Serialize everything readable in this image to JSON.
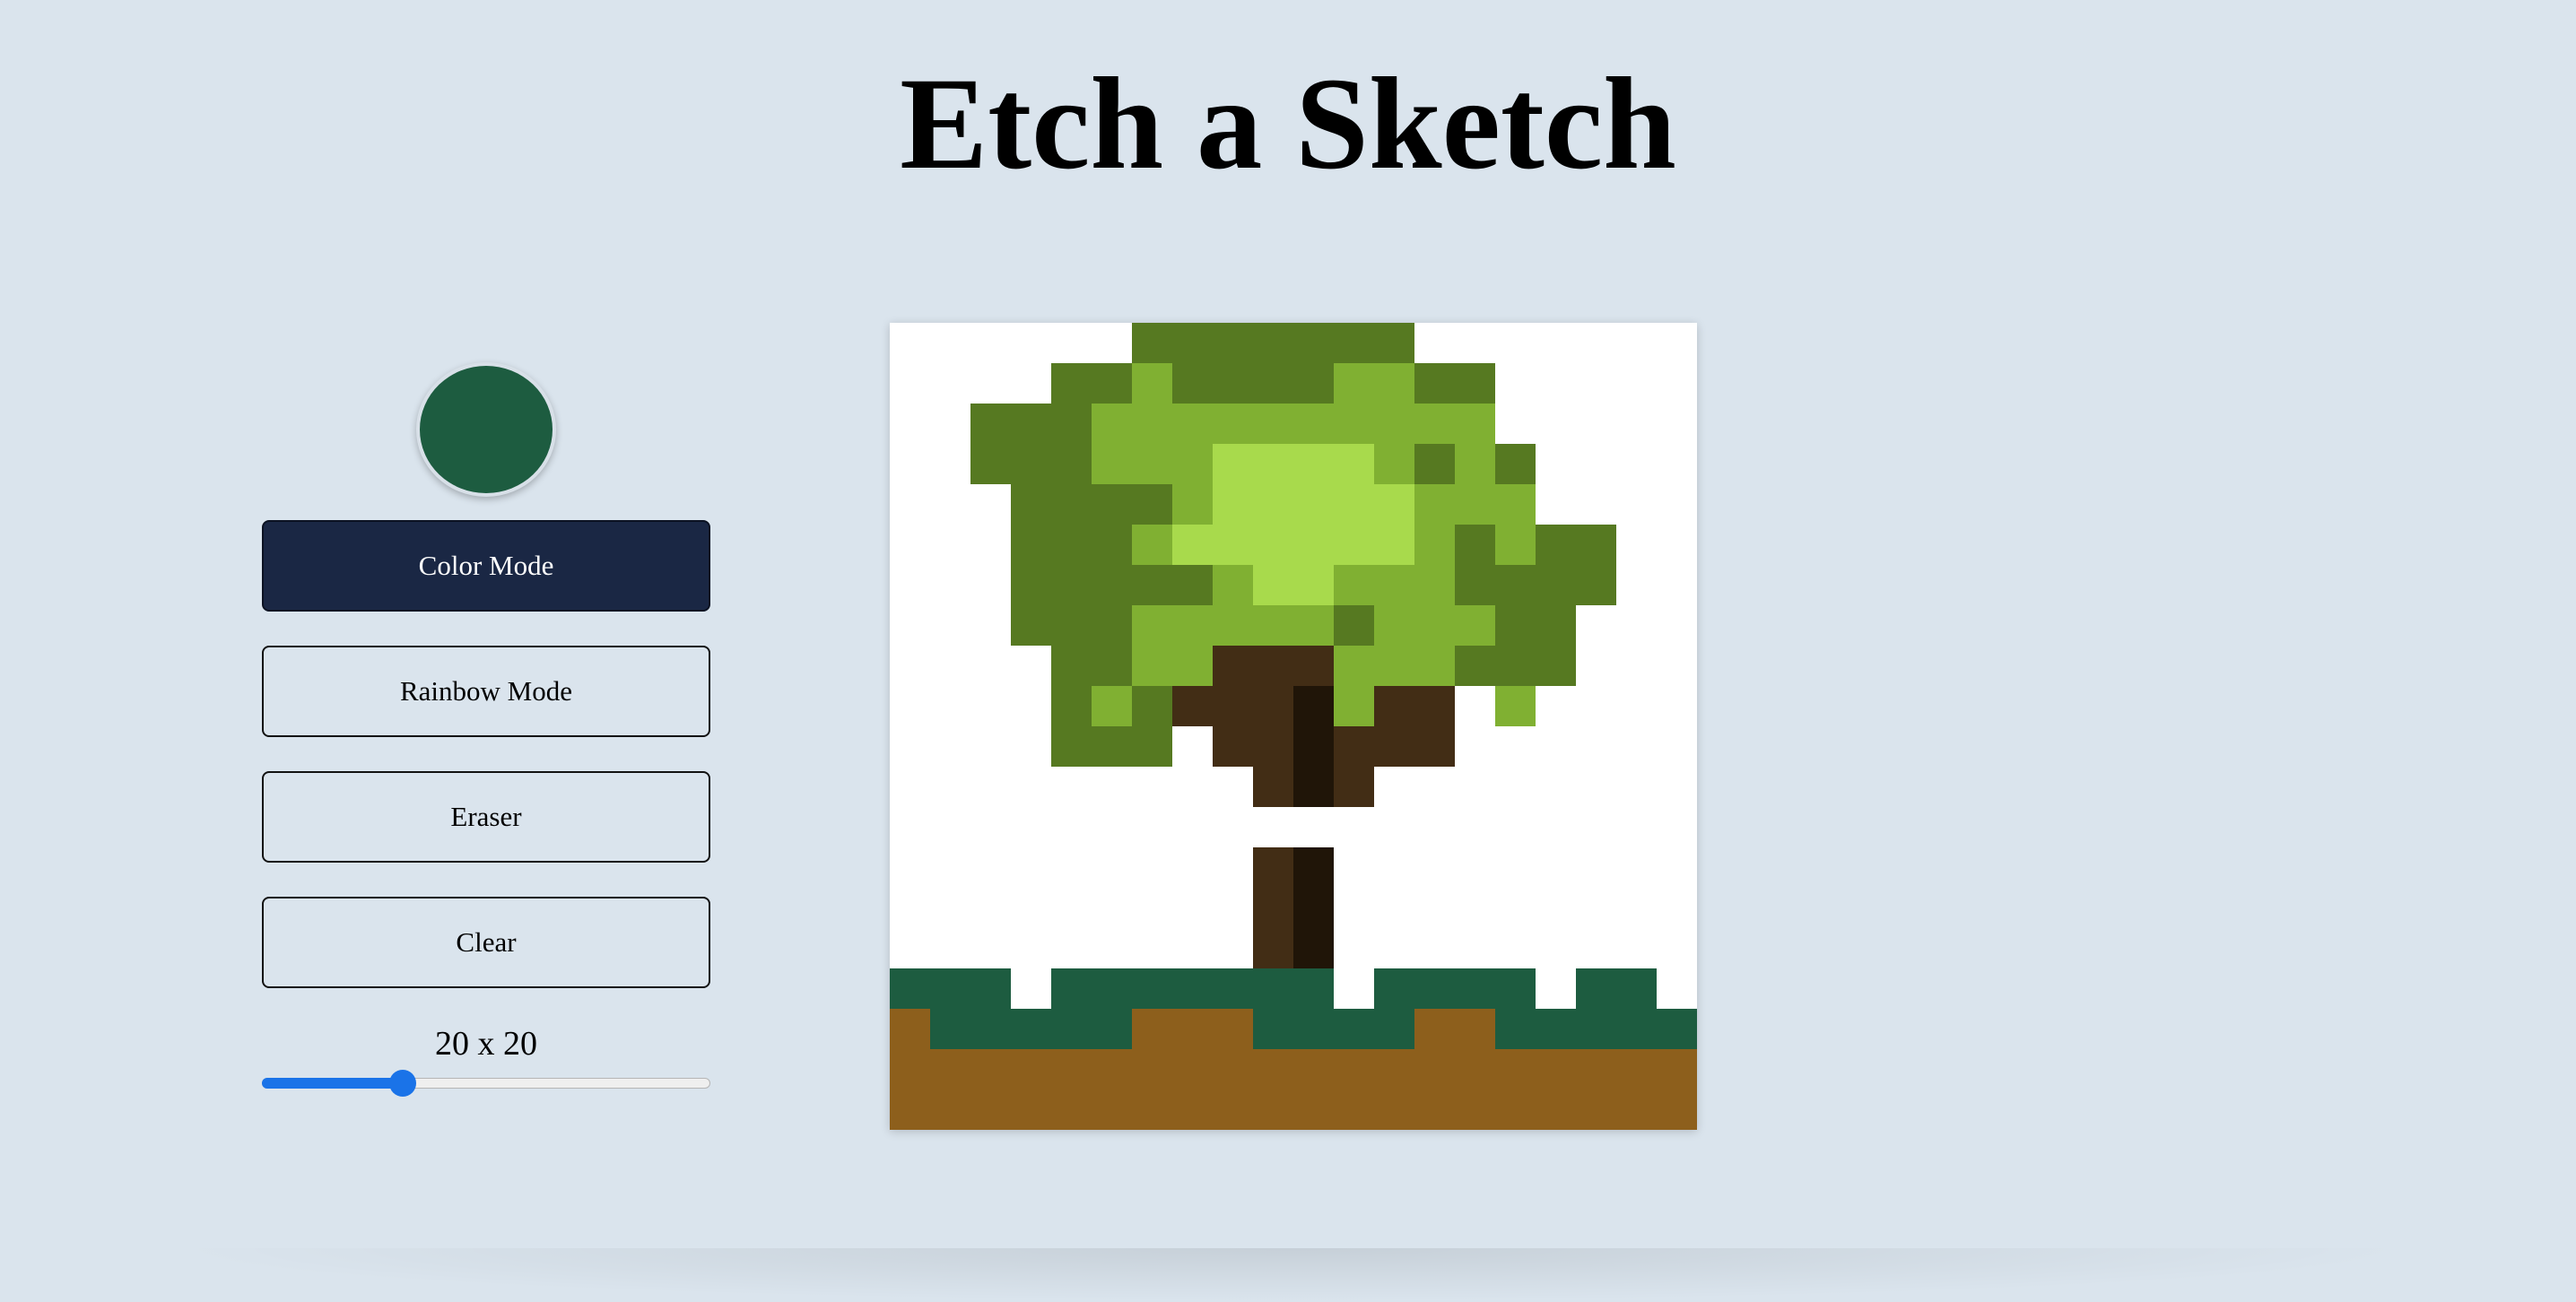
{
  "page": {
    "title": "Etch a Sketch"
  },
  "controls": {
    "current_color": "#1d5c40",
    "buttons": [
      {
        "label": "Color Mode",
        "active": true
      },
      {
        "label": "Rainbow Mode",
        "active": false
      },
      {
        "label": "Eraser",
        "active": false
      },
      {
        "label": "Clear",
        "active": false
      }
    ],
    "grid_size_label": "20 x 20",
    "grid_size": {
      "value": 20,
      "min": 1,
      "max": 64
    }
  },
  "sketch": {
    "rows": 20,
    "cols": 20,
    "palette": {
      ".": "#ffffff",
      "D": "#567921",
      "M": "#80b032",
      "L": "#a8da4c",
      "B": "#422d15",
      "K": "#201508",
      "G": "#1d5c40",
      "E": "#8d5f1c"
    },
    "pixels": [
      "......DDDDDDD.......",
      "....DDMDDDDMMDD.....",
      "..DDDMMMMMMMMMM.....",
      "..DDDMMMLLLLMDMD....",
      "...DDDDMLLLLLMMM....",
      "...DDDMLLLLLLMDMDD..",
      "...DDDDDMLLMMMDDDD..",
      "...DDDMMMMMDMMMDD...",
      "....DDMMBBBMMMDDD...",
      "....DMDBBBKMBB.M....",
      "....DDD.BBKBBB......",
      ".........BKB........",
      "....................",
      ".........BK.........",
      ".........BK.........",
      ".........BK.........",
      "GGG.GGGGGGG.GGGG.GG.",
      "EGGGGGEEEGGGGEEGGGGG",
      "EEEEEEEEEEEEEEEEEEEE",
      "EEEEEEEEEEEEEEEEEEEE"
    ]
  }
}
